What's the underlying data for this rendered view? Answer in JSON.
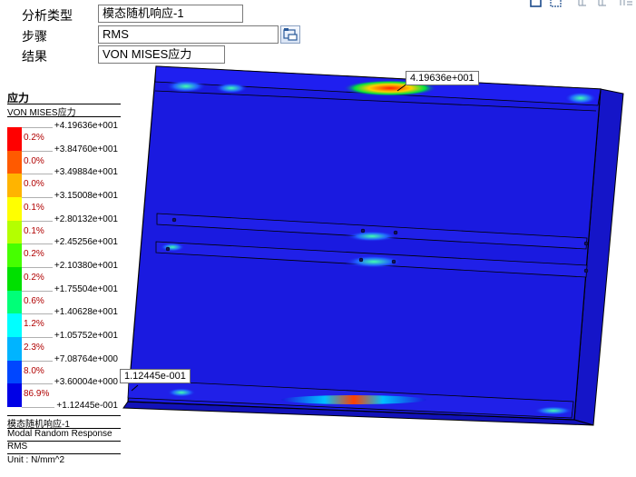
{
  "form": {
    "analysis_type": {
      "label": "分析类型",
      "value": "模态随机响应-1"
    },
    "step": {
      "label": "步骤",
      "value": "RMS"
    },
    "result": {
      "label": "结果",
      "value": "VON MISES应力"
    }
  },
  "toolbar": {
    "icons": [
      "frame-view-icon",
      "dotted-frame-icon",
      "probe-icon",
      "probe-grey-icon",
      "probe-list-icon"
    ]
  },
  "legend": {
    "title": "应力",
    "subtitle": "VON MISES应力",
    "ticks": [
      "+4.19636e+001",
      "+3.84760e+001",
      "+3.49884e+001",
      "+3.15008e+001",
      "+2.80132e+001",
      "+2.45256e+001",
      "+2.10380e+001",
      "+1.75504e+001",
      "+1.40628e+001",
      "+1.05752e+001",
      "+7.08764e+000",
      "+3.60004e+000",
      "+1.12445e-001"
    ],
    "segments": [
      {
        "percent": "0.2%",
        "color": "#ff0000"
      },
      {
        "percent": "0.0%",
        "color": "#ff5a00"
      },
      {
        "percent": "0.0%",
        "color": "#ffb400"
      },
      {
        "percent": "0.1%",
        "color": "#ffff00"
      },
      {
        "percent": "0.1%",
        "color": "#b4ff00"
      },
      {
        "percent": "0.2%",
        "color": "#46ff00"
      },
      {
        "percent": "0.2%",
        "color": "#00e000"
      },
      {
        "percent": "0.6%",
        "color": "#00ff78"
      },
      {
        "percent": "1.2%",
        "color": "#00ffff"
      },
      {
        "percent": "2.3%",
        "color": "#00b4ff"
      },
      {
        "percent": "8.0%",
        "color": "#0046ff"
      },
      {
        "percent": "86.9%",
        "color": "#0000e6"
      }
    ],
    "footer": {
      "case": "模态随机响应-1",
      "response": "Modal Random Response",
      "step": "RMS",
      "unit": "Unit : N/mm^2"
    }
  },
  "viewport": {
    "max_tag": "4.19636e+001",
    "min_tag": "1.12445e-001",
    "model_color": "#1a1ae0",
    "outline_color": "#000000"
  }
}
